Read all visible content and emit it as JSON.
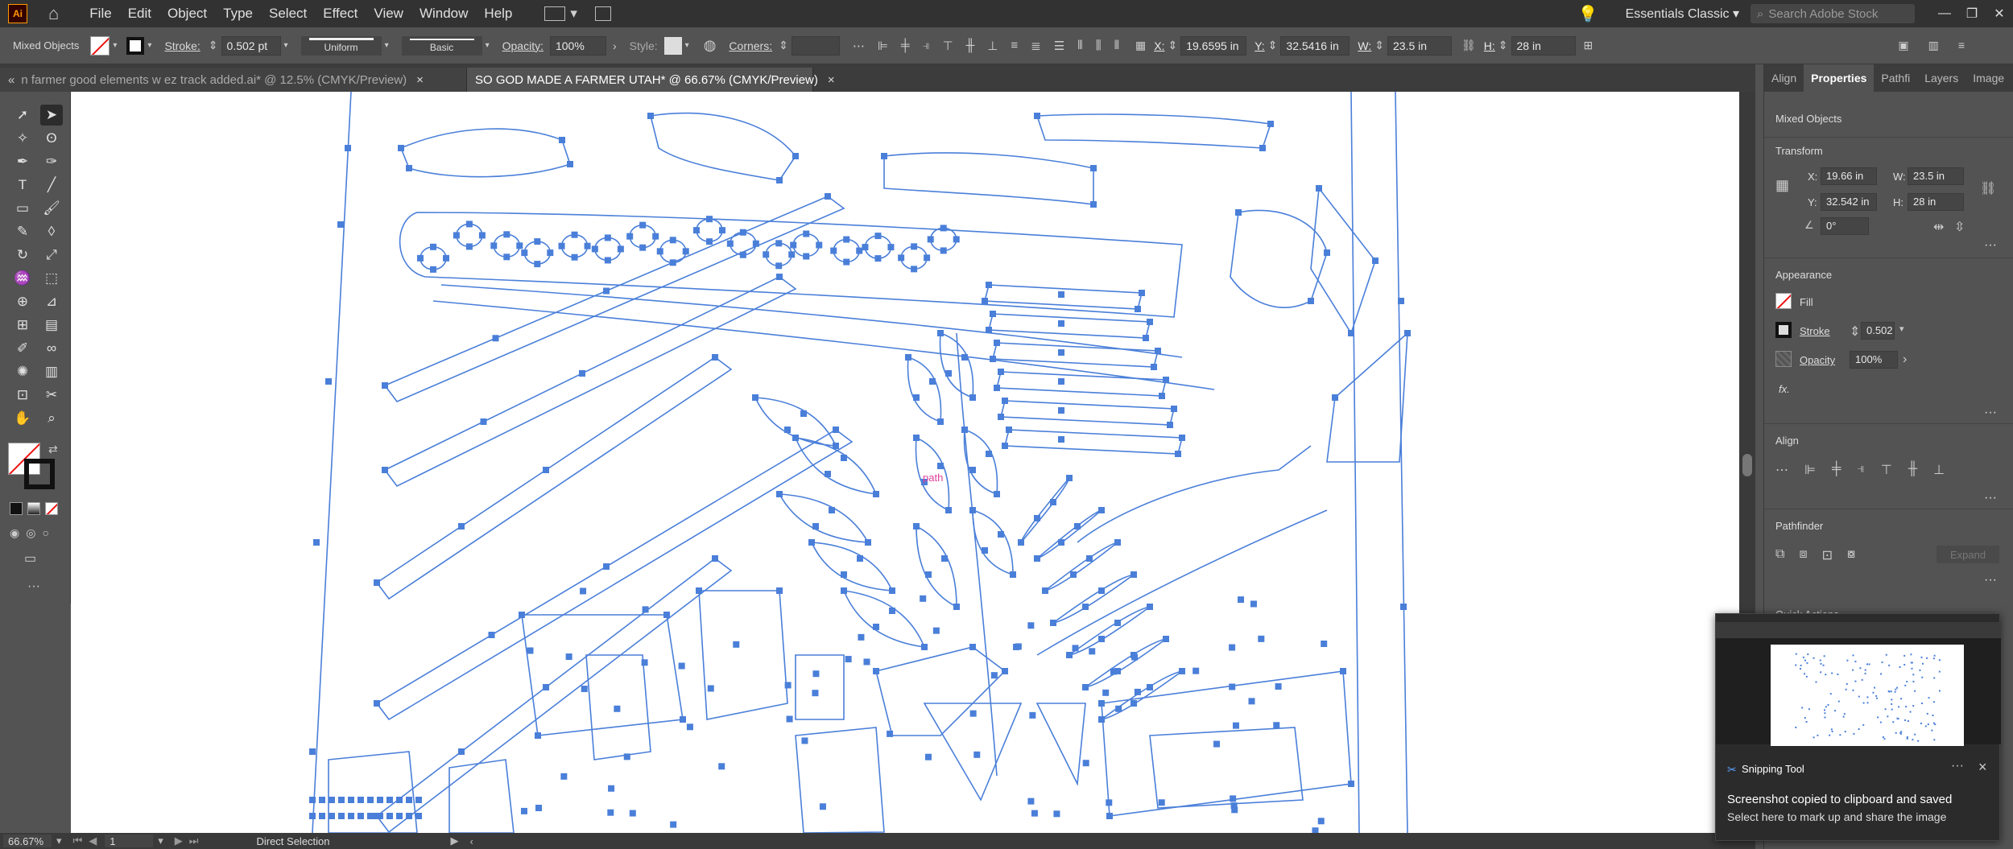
{
  "app": {
    "logo": "Ai",
    "menus": [
      "File",
      "Edit",
      "Object",
      "Type",
      "Select",
      "Effect",
      "View",
      "Window",
      "Help"
    ],
    "workspace": "Essentials Classic",
    "search_placeholder": "Search Adobe Stock"
  },
  "control_bar": {
    "selection_type": "Mixed Objects",
    "stroke_label": "Stroke:",
    "stroke_value": "0.502 pt",
    "profile": "Uniform",
    "brush": "Basic",
    "opacity_label": "Opacity:",
    "opacity_value": "100%",
    "style_label": "Style:",
    "corners_label": "Corners:",
    "x_label": "X:",
    "x_value": "19.6595 in",
    "y_label": "Y:",
    "y_value": "32.5416 in",
    "w_label": "W:",
    "w_value": "23.5 in",
    "h_label": "H:",
    "h_value": "28 in"
  },
  "tabs": [
    {
      "label": "n farmer good elements w ez track added.ai* @ 12.5% (CMYK/Preview)",
      "close": "×"
    },
    {
      "label": "SO GOD MADE A FARMER UTAH* @ 66.67% (CMYK/Preview)",
      "close": "×"
    }
  ],
  "canvas": {
    "path_label": "path",
    "accent_color": "#4a7fd9"
  },
  "status_bar": {
    "zoom": "66.67%",
    "artboard": "1",
    "tool": "Direct Selection"
  },
  "properties_panel": {
    "tabs": [
      "Align",
      "Properties",
      "Pathfi",
      "Layers",
      "Image"
    ],
    "selection_type": "Mixed Objects",
    "transform_title": "Transform",
    "x_label": "X:",
    "x_value": "19.66 in",
    "w_label": "W:",
    "w_value": "23.5 in",
    "y_label": "Y:",
    "y_value": "32.542 in",
    "h_label": "H:",
    "h_value": "28 in",
    "angle_value": "0°",
    "appearance_title": "Appearance",
    "fill_label": "Fill",
    "stroke_label": "Stroke",
    "stroke_value": "0.502",
    "opacity_label": "Opacity",
    "opacity_value": "100%",
    "fx_label": "fx.",
    "align_title": "Align",
    "pathfinder_title": "Pathfinder",
    "expand_label": "Expand",
    "quick_actions_title": "Quick Actions"
  },
  "toast": {
    "app_name": "Snipping Tool",
    "title": "Screenshot copied to clipboard and saved",
    "subtitle": "Select here to mark up and share the image",
    "more": "···",
    "close": "×"
  }
}
